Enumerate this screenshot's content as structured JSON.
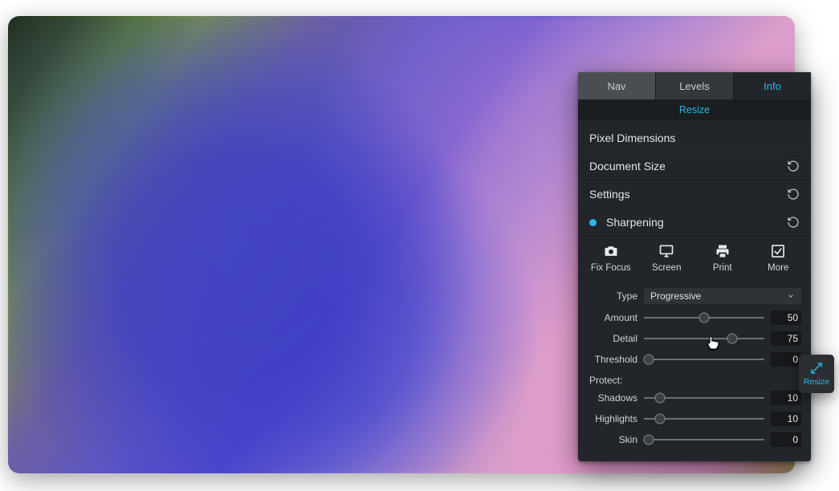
{
  "panel": {
    "tabs": {
      "nav": "Nav",
      "levels": "Levels",
      "info": "Info",
      "active": "info"
    },
    "subheader": "Resize",
    "sections": {
      "pixel": {
        "title": "Pixel Dimensions"
      },
      "docsize": {
        "title": "Document Size"
      },
      "settings": {
        "title": "Settings"
      },
      "sharpening": {
        "title": "Sharpening",
        "enabled": true
      }
    },
    "buttons": {
      "fixfocus": "Fix Focus",
      "screen": "Screen",
      "print": "Print",
      "more": "More"
    },
    "type": {
      "label": "Type",
      "value": "Progressive"
    },
    "sliders": {
      "amount": {
        "label": "Amount",
        "value": 50,
        "max": 100
      },
      "detail": {
        "label": "Detail",
        "value": 75,
        "max": 100
      },
      "threshold": {
        "label": "Threshold",
        "value": 0,
        "max": 100
      },
      "shadows": {
        "label": "Shadows",
        "value": 10,
        "max": 100
      },
      "highlights": {
        "label": "Highlights",
        "value": 10,
        "max": 100
      },
      "skin": {
        "label": "Skin",
        "value": 0,
        "max": 100
      }
    },
    "protect_label": "Protect:"
  },
  "chip": {
    "label": "Resize"
  }
}
